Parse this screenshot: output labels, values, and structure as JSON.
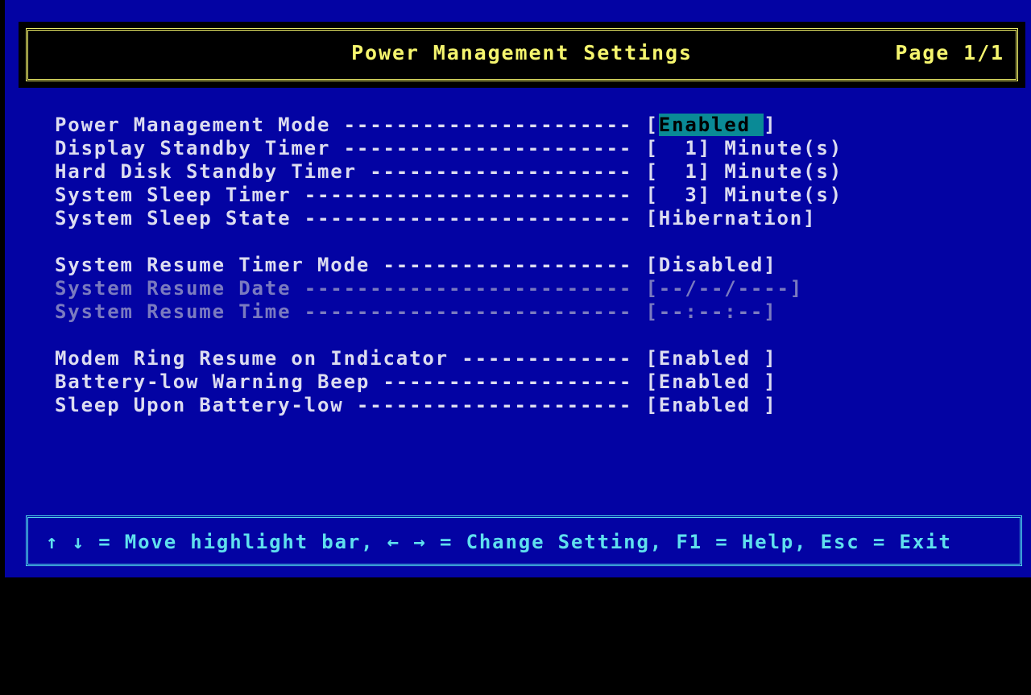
{
  "header": {
    "title": "Power Management Settings",
    "page": "Page 1/1"
  },
  "settings": [
    {
      "label": "Power Management Mode",
      "leader": " ---------------------- ",
      "open": "[",
      "value": "Enabled ",
      "close": "]",
      "unit": "",
      "selected": true,
      "enabled": true
    },
    {
      "label": "Display Standby Timer",
      "leader": " ---------------------- ",
      "open": "[",
      "value": "  1",
      "close": "]",
      "unit": " Minute(s)",
      "selected": false,
      "enabled": true
    },
    {
      "label": "Hard Disk Standby Timer",
      "leader": " -------------------- ",
      "open": "[",
      "value": "  1",
      "close": "]",
      "unit": " Minute(s)",
      "selected": false,
      "enabled": true
    },
    {
      "label": "System Sleep Timer",
      "leader": " ------------------------- ",
      "open": "[",
      "value": "  3",
      "close": "]",
      "unit": " Minute(s)",
      "selected": false,
      "enabled": true
    },
    {
      "label": "System Sleep State",
      "leader": " ------------------------- ",
      "open": "[",
      "value": "Hibernation",
      "close": "]",
      "unit": "",
      "selected": false,
      "enabled": true
    },
    {
      "label": "System Resume Timer Mode",
      "leader": " ------------------- ",
      "open": "[",
      "value": "Disabled",
      "close": "]",
      "unit": "",
      "selected": false,
      "enabled": true
    },
    {
      "label": "System Resume Date",
      "leader": " ------------------------- ",
      "open": "[",
      "value": "--/--/----",
      "close": "]",
      "unit": "",
      "selected": false,
      "enabled": false
    },
    {
      "label": "System Resume Time",
      "leader": " ------------------------- ",
      "open": "[",
      "value": "--:--:--",
      "close": "]",
      "unit": "",
      "selected": false,
      "enabled": false
    },
    {
      "label": "Modem Ring Resume on Indicator",
      "leader": " ------------- ",
      "open": "[",
      "value": "Enabled ",
      "close": "]",
      "unit": "",
      "selected": false,
      "enabled": true
    },
    {
      "label": "Battery-low Warning Beep",
      "leader": " ------------------- ",
      "open": "[",
      "value": "Enabled ",
      "close": "]",
      "unit": "",
      "selected": false,
      "enabled": true
    },
    {
      "label": "Sleep Upon Battery-low",
      "leader": " --------------------- ",
      "open": "[",
      "value": "Enabled ",
      "close": "]",
      "unit": "",
      "selected": false,
      "enabled": true
    }
  ],
  "footer": {
    "help": "↑ ↓ = Move highlight bar, ← → = Change Setting, F1 = Help, Esc = Exit"
  },
  "colors": {
    "background": "#0303a3",
    "title_text": "#f5f56e",
    "body_text": "#dcdcf0",
    "disabled_text": "#7a7ac0",
    "highlight": "#0a8a96",
    "footer_text": "#5fe0ee"
  }
}
